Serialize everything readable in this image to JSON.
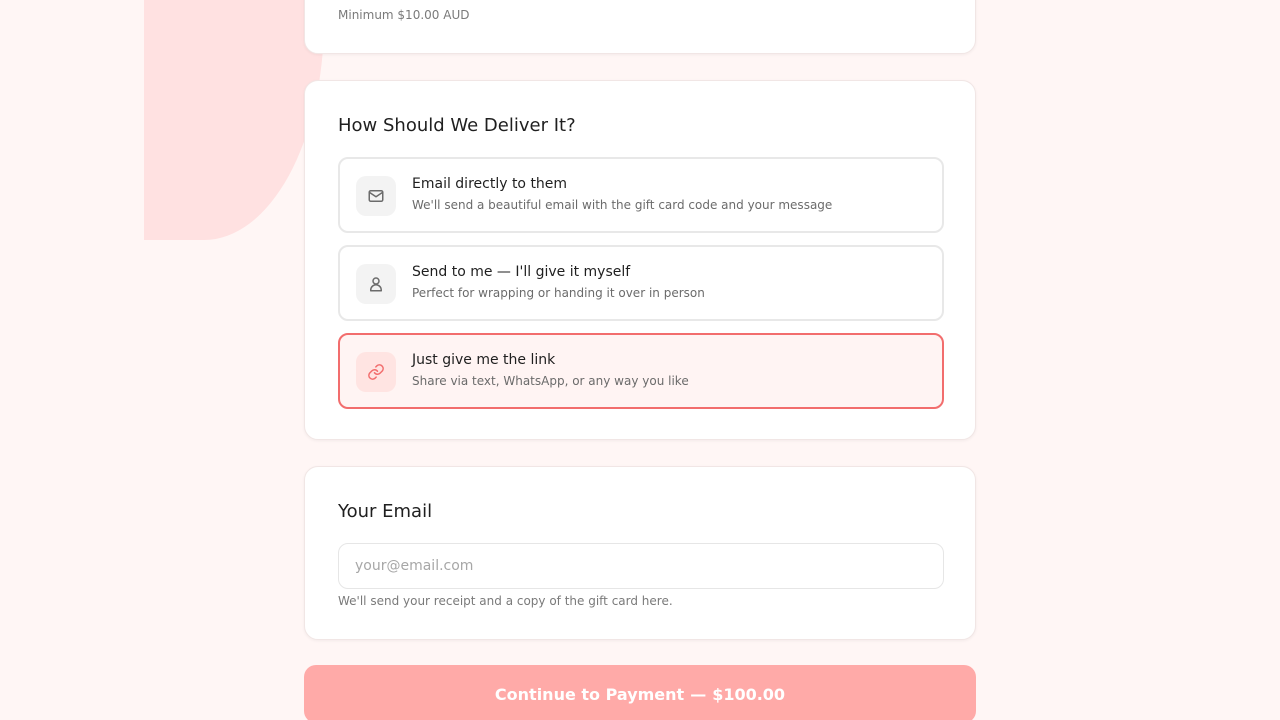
{
  "amount": {
    "minimum_note": "Minimum $10.00 AUD"
  },
  "delivery": {
    "title": "How Should We Deliver It?",
    "options": [
      {
        "icon": "mail-icon",
        "title": "Email directly to them",
        "description": "We'll send a beautiful email with the gift card code and your message",
        "selected": false
      },
      {
        "icon": "user-icon",
        "title": "Send to me — I'll give it myself",
        "description": "Perfect for wrapping or handing it over in person",
        "selected": false
      },
      {
        "icon": "link-icon",
        "title": "Just give me the link",
        "description": "Share via text, WhatsApp, or any way you like",
        "selected": true
      }
    ]
  },
  "your_email": {
    "title": "Your Email",
    "placeholder": "your@email.com",
    "value": "",
    "help": "We'll send your receipt and a copy of the gift card here."
  },
  "payment": {
    "label": "Continue to Payment",
    "separator": "—",
    "amount": "$100.00"
  },
  "colors": {
    "accent": "#f26d6d",
    "button_disabled": "#ffaaa8",
    "background": "#fff6f5",
    "blob": "#ffe1e1"
  }
}
